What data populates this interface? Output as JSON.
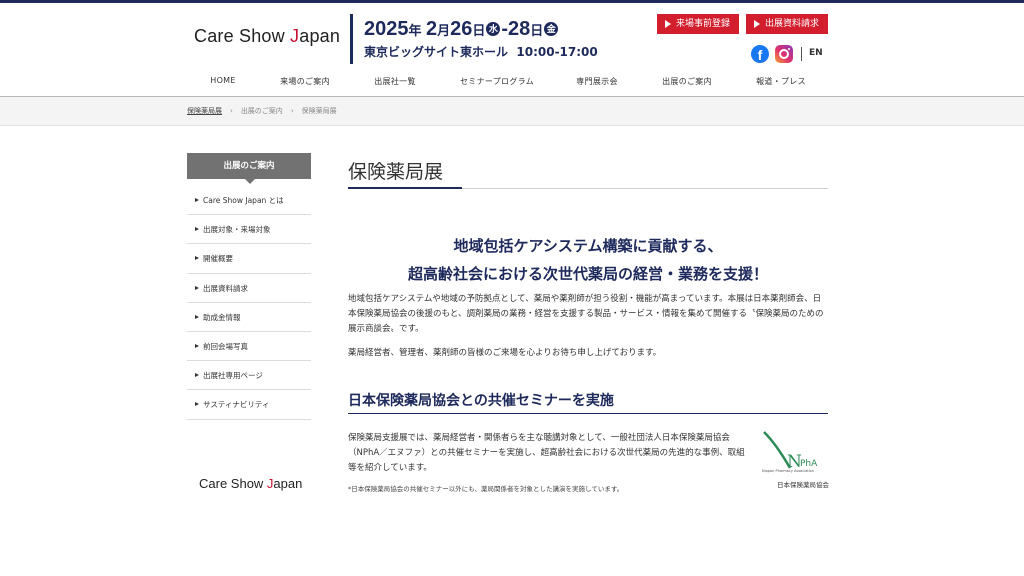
{
  "header": {
    "logo_main": "Care Show ",
    "logo_j": "J",
    "logo_rest": "apan",
    "year": "2025",
    "nen": "年",
    "month": "2",
    "tsuki": "月",
    "day_start": "26",
    "nichi1": "日",
    "weekday_start": "水",
    "dash": "-",
    "day_end": "28",
    "nichi2": "日",
    "weekday_end": "金",
    "venue": "東京ビッグサイト東ホール",
    "hours": "10:00-17:00",
    "btn_visit": "来場事前登録",
    "btn_docs": "出展資料請求",
    "fb_glyph": "f",
    "lang": "EN"
  },
  "nav": [
    "HOME",
    "来場のご案内",
    "出展社一覧",
    "セミナープログラム",
    "専門展示会",
    "出展のご案内",
    "報道・プレス"
  ],
  "breadcrumb": {
    "home": "保険薬局展",
    "sep": "›",
    "level2": "出展のご案内",
    "current": "保険薬局展"
  },
  "sidebar": {
    "heading": "出展のご案内",
    "items": [
      "Care Show Japan とは",
      "出展対象・来場対象",
      "開催概要",
      "出展資料請求",
      "助成金情報",
      "前回会場写真",
      "出展社専用ページ",
      "サスティナビリティ"
    ],
    "logo_main": "Care Show ",
    "logo_j": "J",
    "logo_rest": "apan"
  },
  "main": {
    "title": "保険薬局展",
    "lead_line1": "地域包括ケアシステム構築に貢献する、",
    "lead_line2": "超高齢社会における次世代薬局の経営・業務を支援！",
    "para1": "地域包括ケアシステムや地域の予防拠点として、薬局や薬剤師が担う役割・機能が高まっています。本展は日本薬剤師会、日本保険薬局協会の後援のもと、調剤薬局の業務・経営を支援する製品・サービス・情報を集めて開催する〝保険薬局のための展示商談会〟です。",
    "para2": "薬局経営者、管理者、薬剤師の皆様のご来場を心よりお待ち申し上げております。",
    "section_heading": "日本保険薬局協会との共催セミナーを実施",
    "para3": "保険薬局支援展では、薬局経営者・関係者らを主な聴講対象として、一般社団法人日本保険薬局協会（NPhA／エヌファ）との共催セミナーを実施し、超高齢社会における次世代薬局の先進的な事例、取組等を紹介しています。",
    "note": "*日本保険薬局協会の共催セミナー以外にも、薬局関係者を対象とした講演を実施しています。",
    "nph_text": "PhA",
    "nph_n": "N",
    "nph_tagline": "Nippon Pharmacy Association",
    "nph_caption": "日本保険薬局協会"
  },
  "colors": {
    "navy": "#1e2a5c",
    "red": "#d31e2d",
    "sidebar_head": "#727272",
    "nph_green": "#2e8b57"
  }
}
